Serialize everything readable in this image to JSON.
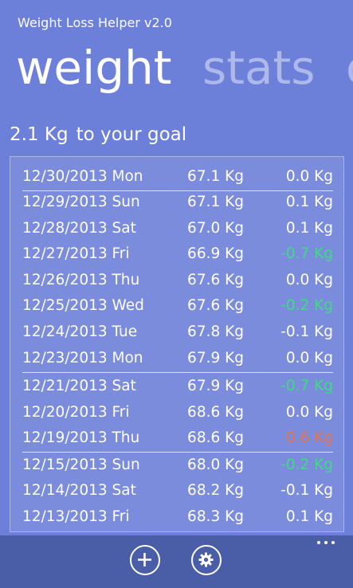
{
  "app": {
    "title": "Weight Loss Helper v2.0"
  },
  "pivot": {
    "items": [
      "weight",
      "stats",
      "ch"
    ]
  },
  "goal": {
    "amount": "2.1 Kg",
    "text": "to your goal"
  },
  "entries": [
    {
      "date": "12/30/2013 Mon",
      "weight": "67.1 Kg",
      "change": "0.0 Kg",
      "status": "neutral"
    },
    {
      "date": "12/29/2013 Sun",
      "weight": "67.1 Kg",
      "change": "0.1 Kg",
      "status": "neutral"
    },
    {
      "date": "12/28/2013 Sat",
      "weight": "67.0 Kg",
      "change": "0.1 Kg",
      "status": "neutral"
    },
    {
      "date": "12/27/2013 Fri",
      "weight": "66.9 Kg",
      "change": "-0.7 Kg",
      "status": "loss"
    },
    {
      "date": "12/26/2013 Thu",
      "weight": "67.6 Kg",
      "change": "0.0 Kg",
      "status": "neutral"
    },
    {
      "date": "12/25/2013 Wed",
      "weight": "67.6 Kg",
      "change": "-0.2 Kg",
      "status": "loss"
    },
    {
      "date": "12/24/2013 Tue",
      "weight": "67.8 Kg",
      "change": "-0.1 Kg",
      "status": "neutral"
    },
    {
      "date": "12/23/2013 Mon",
      "weight": "67.9 Kg",
      "change": "0.0 Kg",
      "status": "neutral"
    },
    {
      "date": "12/21/2013 Sat",
      "weight": "67.9 Kg",
      "change": "-0.7 Kg",
      "status": "loss"
    },
    {
      "date": "12/20/2013 Fri",
      "weight": "68.6 Kg",
      "change": "0.0 Kg",
      "status": "neutral"
    },
    {
      "date": "12/19/2013 Thu",
      "weight": "68.6 Kg",
      "change": "0.6 Kg",
      "status": "gain"
    },
    {
      "date": "12/15/2013 Sun",
      "weight": "68.0 Kg",
      "change": "-0.2 Kg",
      "status": "loss"
    },
    {
      "date": "12/14/2013 Sat",
      "weight": "68.2 Kg",
      "change": "-0.1 Kg",
      "status": "neutral"
    },
    {
      "date": "12/13/2013 Fri",
      "weight": "68.3 Kg",
      "change": "0.1 Kg",
      "status": "neutral"
    }
  ],
  "colors": {
    "background": "#6c7fd9",
    "appbar": "#4a5da7",
    "loss": "#3ddc84",
    "gain": "#e8734a",
    "neutral": "#ffffff"
  },
  "appbar": {
    "buttons": [
      {
        "name": "add-button",
        "icon": "plus-icon"
      },
      {
        "name": "settings-button",
        "icon": "gear-icon"
      }
    ],
    "more": "ellipsis-icon"
  }
}
